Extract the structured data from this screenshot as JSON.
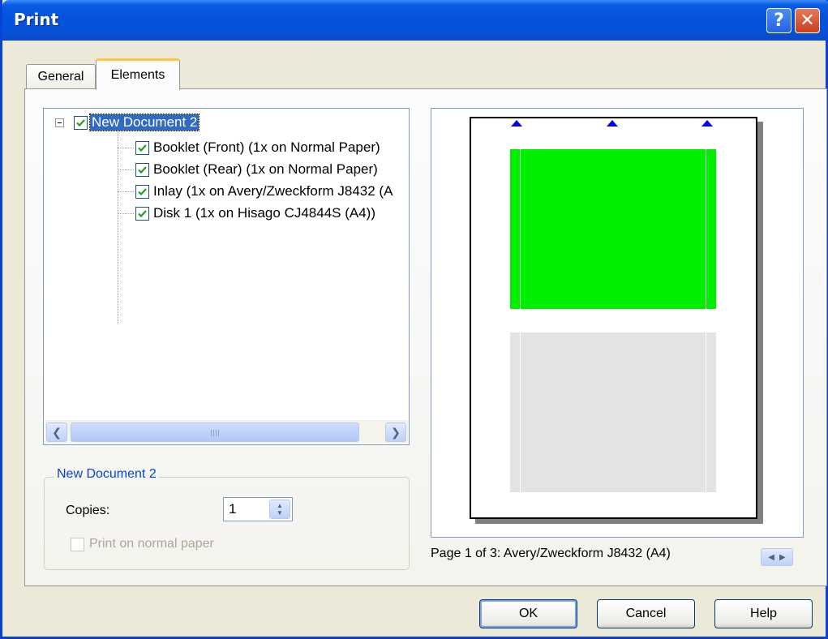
{
  "window": {
    "title": "Print",
    "help_glyph": "?",
    "close_glyph": "✕"
  },
  "tabs": [
    {
      "label": "General",
      "active": false
    },
    {
      "label": "Elements",
      "active": true
    }
  ],
  "tree": {
    "root": {
      "label": "New Document 2",
      "checked": true,
      "expanded": true
    },
    "items": [
      {
        "label": "Booklet  (Front) (1x on Normal Paper)",
        "checked": true
      },
      {
        "label": "Booklet  (Rear) (1x on Normal Paper)",
        "checked": true
      },
      {
        "label": "Inlay (1x on Avery/Zweckform J8432 (A",
        "checked": true
      },
      {
        "label": "Disk 1 (1x on Hisago CJ4844S (A4))",
        "checked": true
      }
    ],
    "scroll_grip": "III"
  },
  "group": {
    "title": "New Document 2",
    "copies_label": "Copies:",
    "copies_value": "1",
    "normal_paper_label": "Print on normal paper",
    "normal_paper_checked": false,
    "normal_paper_enabled": false
  },
  "preview": {
    "caption": "Page 1 of 3: Avery/Zweckform J8432 (A4)",
    "label_colors": {
      "first": "#00ee00",
      "second": "#e3e3e3"
    },
    "marker_color": "#0000e6"
  },
  "buttons": {
    "ok": "OK",
    "cancel": "Cancel",
    "help": "Help"
  },
  "colors": {
    "titlebar": "#0553dc",
    "dialog_bg": "#ece9d8",
    "selection": "#316ac5",
    "group_title": "#0046d5"
  }
}
